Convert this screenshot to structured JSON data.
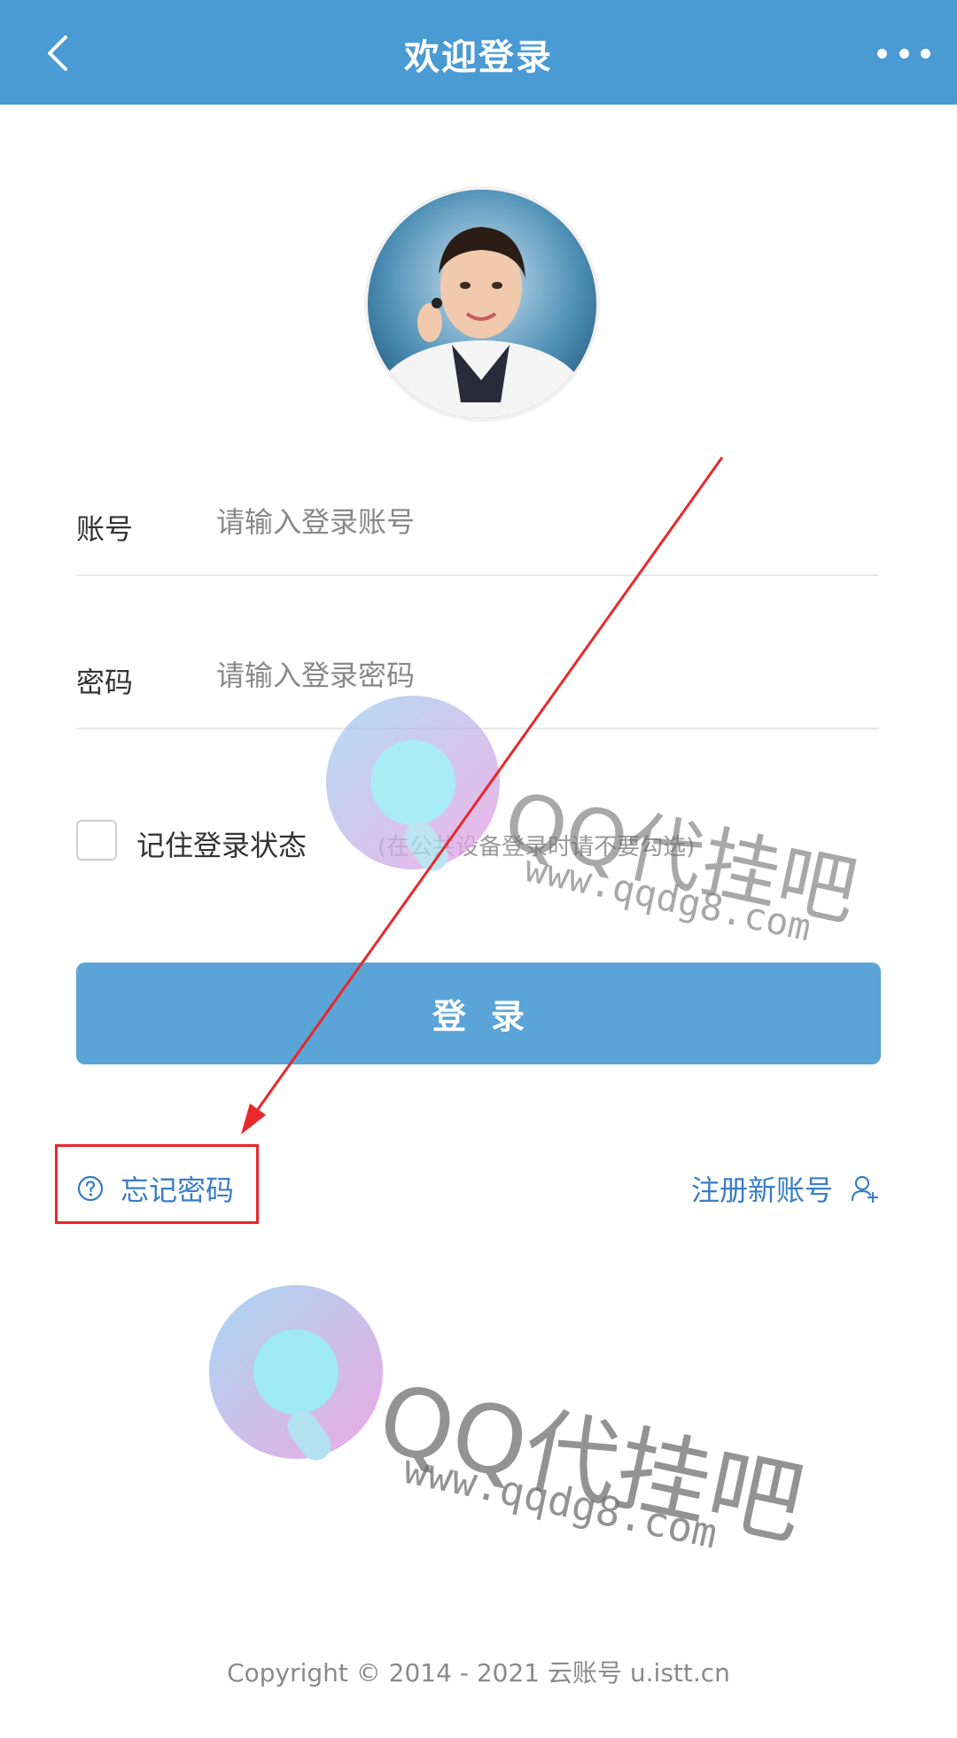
{
  "header": {
    "title": "欢迎登录",
    "back_icon": "chevron-left-icon",
    "more_icon": "more-horizontal-icon",
    "background_color": "#4a9ad4"
  },
  "form": {
    "account_label": "账号",
    "account_placeholder": "请输入登录账号",
    "password_label": "密码",
    "password_placeholder": "请输入登录密码",
    "remember_label": "记住登录状态",
    "remember_hint": "(在公共设备登录时请不要勾选)",
    "remember_checked": false,
    "login_label": "登录",
    "login_color": "#5ba4d7"
  },
  "links": {
    "forgot_password": "忘记密码",
    "forgot_icon": "help-circle-icon",
    "register": "注册新账号",
    "register_icon": "add-user-icon",
    "link_color": "#3a7dc4"
  },
  "watermark": {
    "brand": "QQ代挂吧",
    "url": "www.qqdg8.com"
  },
  "footer": {
    "copyright": "Copyright © 2014 - 2021 云账号 u.istt.cn"
  },
  "annotation": {
    "highlight_color": "#e8282b"
  }
}
